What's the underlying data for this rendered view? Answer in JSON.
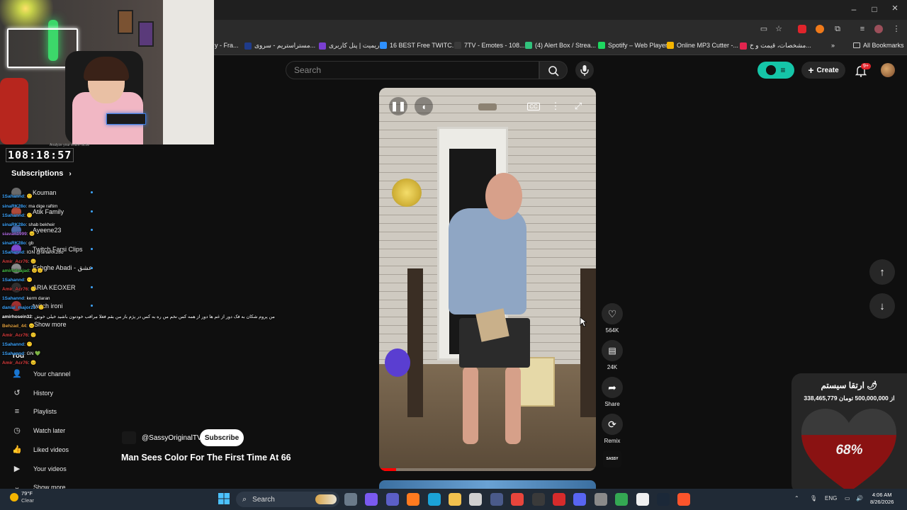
{
  "browser": {
    "window_controls": {
      "minimize": "–",
      "maximize": "□",
      "close": "×"
    },
    "bookmarks": [
      {
        "label": "y - Fra...",
        "color": "#6b6b6b"
      },
      {
        "label": "مستراستریم - سروی...",
        "color": "#1f3b8a"
      },
      {
        "label": "ریمیت | پنل کاربری",
        "color": "#7a3fd1"
      },
      {
        "label": "16 BEST Free TWITC...",
        "color": "#2e90ff"
      },
      {
        "label": "7TV - Emotes - 108...",
        "color": "#3a3a3a"
      },
      {
        "label": "(4) Alert Box / Strea...",
        "color": "#31c27c"
      },
      {
        "label": "Spotify – Web Player",
        "color": "#1ed760"
      },
      {
        "label": "Online MP3 Cutter -...",
        "color": "#f4b400"
      },
      {
        "label": "مشخصات، قیمت و خ...",
        "color": "#e2244e"
      }
    ],
    "all_bookmarks": "All Bookmarks"
  },
  "youtube": {
    "search_placeholder": "Search",
    "create_label": "Create",
    "notification_badge": "9+",
    "subscriptions_header": "Subscriptions",
    "subscriptions": [
      {
        "name": "Kouman",
        "color": "#6a6a6a"
      },
      {
        "name": "Atik Family",
        "color": "#b04a3a"
      },
      {
        "name": "Ayeene23",
        "color": "#4b6aa8"
      },
      {
        "name": "Twitch Farsi Clips",
        "color": "#7d4ad1"
      },
      {
        "name": "Eshghe Abadi - عشق",
        "color": "#8a8a8a"
      },
      {
        "name": "ARIA KEOXER",
        "color": "#303030"
      },
      {
        "name": "twitch ironi",
        "color": "#a03030"
      }
    ],
    "show_more": "Show more",
    "you_header": "You",
    "you_items": [
      {
        "label": "Your channel",
        "icon": "person-icon",
        "glyph": "👤"
      },
      {
        "label": "History",
        "icon": "history-icon",
        "glyph": "↺"
      },
      {
        "label": "Playlists",
        "icon": "playlists-icon",
        "glyph": "≡"
      },
      {
        "label": "Watch later",
        "icon": "clock-icon",
        "glyph": "◷"
      },
      {
        "label": "Liked videos",
        "icon": "thumbs-up-icon",
        "glyph": "👍"
      },
      {
        "label": "Your videos",
        "icon": "video-icon",
        "glyph": "▶"
      },
      {
        "label": "Show more",
        "icon": "chevron-down-icon",
        "glyph": "⌄"
      }
    ],
    "short": {
      "channel": "@SassyOriginalTV",
      "subscribe": "Subscribe",
      "title": "Man Sees Color For The First Time At 66",
      "likes": "564K",
      "comments": "24K",
      "share": "Share",
      "remix": "Remix",
      "channel_logo_text": "SASSY",
      "progress": 0.08
    }
  },
  "stream": {
    "timer": "108:18:57",
    "timer_caption": "Analyze your entire niche",
    "chat": [
      {
        "user": "1Sahannd",
        "text": ": 🙂",
        "color": "#3ea6ff"
      },
      {
        "user": "sinaRK28o",
        "text": ": ma dige raftim",
        "color": "#3ea6ff"
      },
      {
        "user": "1Sahannd",
        "text": ": 😶",
        "color": "#3ea6ff"
      },
      {
        "user": "sinaRK28o",
        "text": ": shab bekheir",
        "color": "#3ea6ff"
      },
      {
        "user": "siavan1999",
        "text": ": 😐",
        "color": "#b06ae0"
      },
      {
        "user": "sinaRK28o",
        "text": ": gb",
        "color": "#3ea6ff"
      },
      {
        "user": "1Sahannd",
        "text": ": IGN @sinaRK28o",
        "color": "#3ea6ff"
      },
      {
        "user": "Amir_Acr76",
        "text": ": 😐",
        "color": "#e04040"
      },
      {
        "user": "amirtalsajad",
        "text": ": 😐😐",
        "color": "#49c249"
      },
      {
        "user": "1Sahannd",
        "text": ": 😶",
        "color": "#3ea6ff"
      },
      {
        "user": "Amir_Acr76",
        "text": ": 🙂",
        "color": "#e04040"
      },
      {
        "user": "1Sahannd",
        "text": ": kerm daran",
        "color": "#3ea6ff"
      },
      {
        "user": "danial_major21",
        "text": ": 🙂",
        "color": "#3ea6ff"
      },
      {
        "user": "amirhosein32",
        "text": ": من پروم شکان به فک دور از غم ها دور از همه کس نخم من ره به کس در پژم باز من بقم فغلا مرافب خودتون باشید خیلی خوش",
        "color": "#ffffff"
      },
      {
        "user": "Behzad_44",
        "text": ": 😐",
        "color": "#e0a040"
      },
      {
        "user": "Amir_Acr76",
        "text": ": 🙂",
        "color": "#e04040"
      },
      {
        "user": "1Sahannd",
        "text": ": 😶",
        "color": "#3ea6ff"
      },
      {
        "user": "1Sahannd",
        "text": ": GN 💚",
        "color": "#3ea6ff"
      },
      {
        "user": "Amir_Acr76",
        "text": ": 😐",
        "color": "#e04040"
      }
    ],
    "donation": {
      "title": "ارتقا سیستم 🌶",
      "amount": "338,465,779 از 500,000,000 تومان",
      "percent_label": "68%",
      "percent": 0.68
    }
  },
  "taskbar": {
    "weather_temp": "79°F",
    "weather_desc": "Clear",
    "search": "Search",
    "lang": "ENG",
    "time": "4:06 AM",
    "date": "8/26/2026",
    "icons": [
      {
        "name": "task-view-icon",
        "color": "#6a7a8a"
      },
      {
        "name": "copilot-icon",
        "color": "#7a5af0"
      },
      {
        "name": "teams-icon",
        "color": "#5b5fc7"
      },
      {
        "name": "firefox-icon",
        "color": "#ff7a1f"
      },
      {
        "name": "edge-icon",
        "color": "#1ba3d8"
      },
      {
        "name": "explorer-icon",
        "color": "#f2c14e"
      },
      {
        "name": "store-icon",
        "color": "#d0d0d0"
      },
      {
        "name": "app-icon",
        "color": "#4a5a8a"
      },
      {
        "name": "chrome-icon",
        "color": "#e8453c"
      },
      {
        "name": "obs-icon",
        "color": "#3a3a3a"
      },
      {
        "name": "vivaldi-icon",
        "color": "#d62b2b"
      },
      {
        "name": "discord-icon",
        "color": "#5865f2"
      },
      {
        "name": "settings-icon",
        "color": "#8a8a8a"
      },
      {
        "name": "chrome-alt-icon",
        "color": "#34a853"
      },
      {
        "name": "capcut-icon",
        "color": "#f0f0f0"
      },
      {
        "name": "steam-icon",
        "color": "#1b2838"
      },
      {
        "name": "brave-icon",
        "color": "#fb542b"
      }
    ]
  }
}
